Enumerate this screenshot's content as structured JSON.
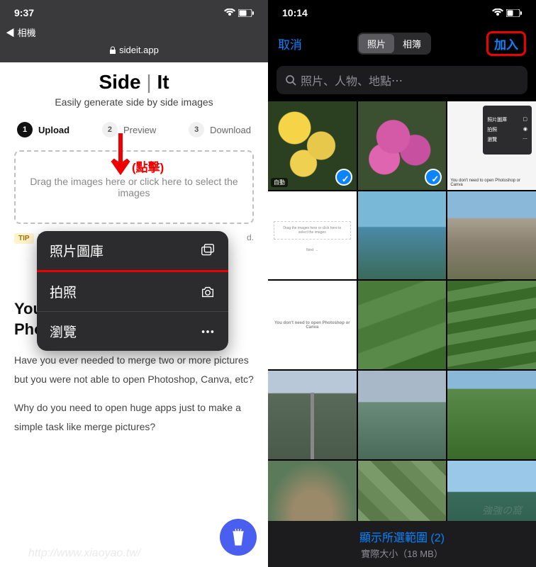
{
  "left": {
    "status_time": "9:37",
    "back_label": "相機",
    "url_domain": "sideit.app",
    "app_title_1": "Side",
    "app_title_2": "It",
    "app_subtitle": "Easily generate side by side images",
    "steps": [
      {
        "num": "1",
        "label": "Upload"
      },
      {
        "num": "2",
        "label": "Preview"
      },
      {
        "num": "3",
        "label": "Download"
      }
    ],
    "annotation_click": "(點擊)",
    "dropzone_text": "Drag the images here or click here to select the images",
    "tip_badge": "TIP",
    "tip_text": "Yo",
    "tip_text_end": "d.",
    "menu": {
      "photo_library": "照片圖庫",
      "take_photo": "拍照",
      "browse": "瀏覽"
    },
    "section_heading": "You don't need to open Photoshop or Canva",
    "section_p1": "Have you ever needed to merge two or more pictures but you were not able to open Photoshop, Canva, etc?",
    "section_p2": "Why do you need to open huge apps just to make a simple task like merge pictures?",
    "watermark": "http://www.xiaoyao.tw/"
  },
  "right": {
    "status_time": "10:14",
    "cancel": "取消",
    "tab_photos": "照片",
    "tab_albums": "相簿",
    "add": "加入",
    "search_placeholder": "照片、人物、地點⋯",
    "thumb_app": {
      "menu1": "照片圖庫",
      "menu2": "拍照",
      "menu3": "瀏覽",
      "caption": "You don't need to open Photoshop or Canva"
    },
    "thumb_mid_caption": "You don't need to open Photoshop or Canva",
    "burst_label": "自動",
    "footer_title": "顯示所選範圍 (2)",
    "footer_sub": "實際大小（18 MB）",
    "watermark": "強強の窩"
  }
}
